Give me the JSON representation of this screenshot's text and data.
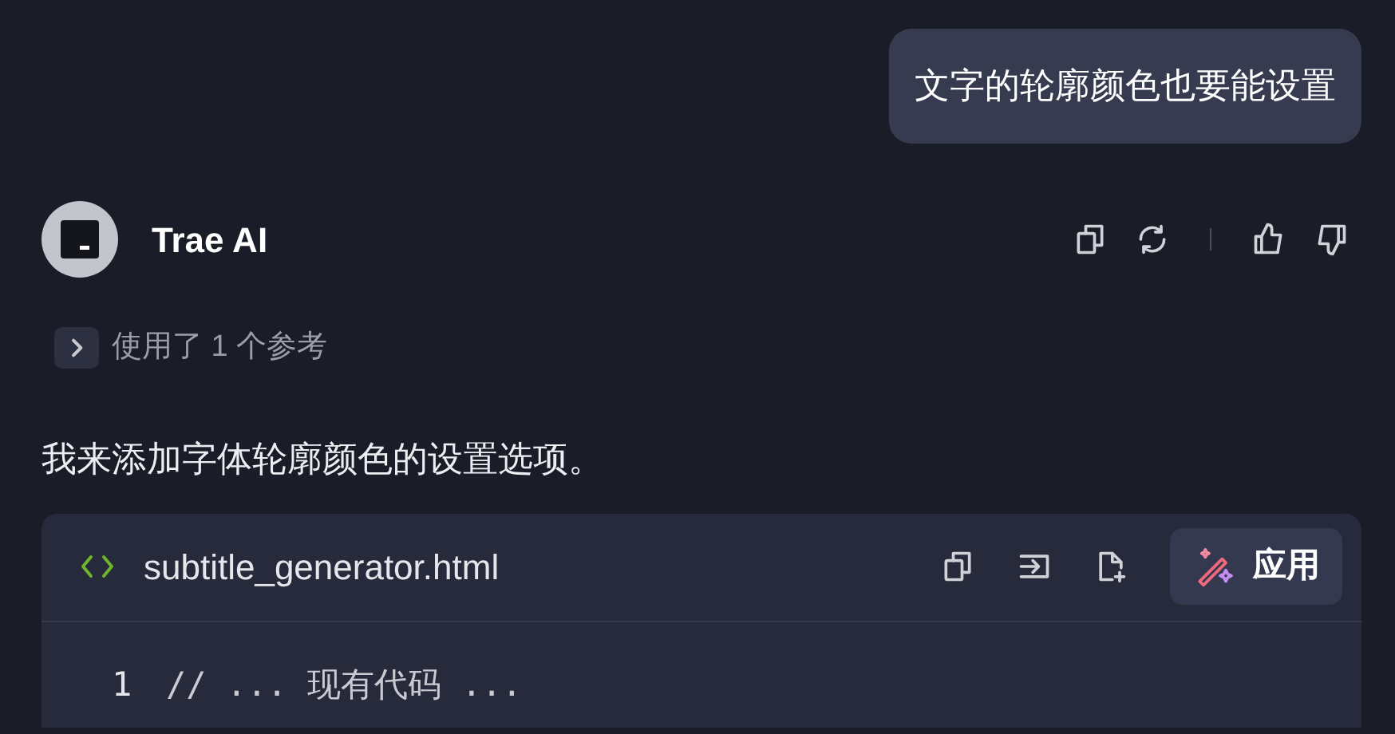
{
  "user_message": {
    "text": "文字的轮廓颜色也要能设置"
  },
  "assistant": {
    "name": "Trae AI",
    "references": {
      "label": "使用了 1 个参考",
      "expanded": false
    },
    "message": "我来添加字体轮廓颜色的设置选项。"
  },
  "code_block": {
    "filename": "subtitle_generator.html",
    "apply_button": "应用",
    "lines": [
      {
        "number": "1",
        "code": "// ... 现有代码 ..."
      }
    ]
  }
}
